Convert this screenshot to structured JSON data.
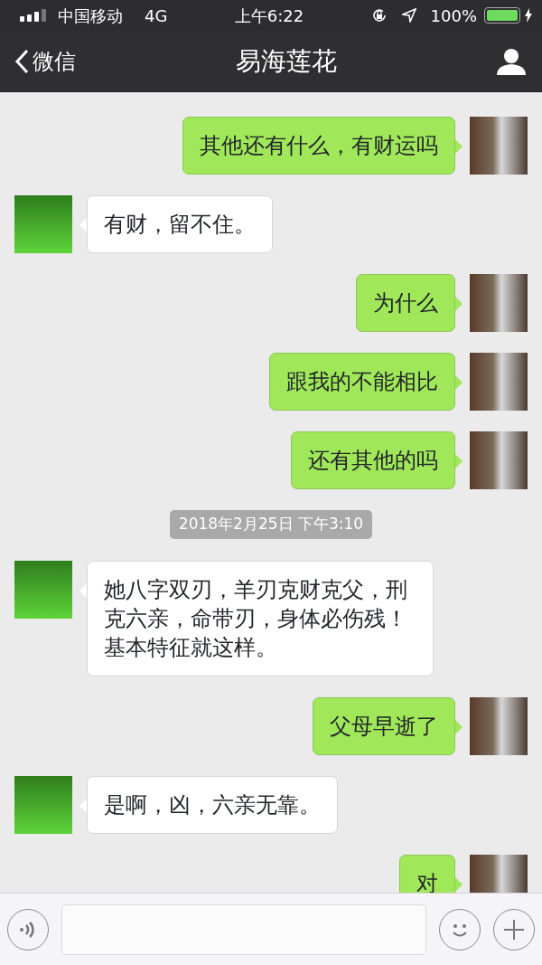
{
  "status_bar": {
    "carrier": "中国移动",
    "network": "4G",
    "time": "上午6:22",
    "battery_text": "100%",
    "battery": {
      "level": 1.0
    }
  },
  "nav": {
    "back_label": "微信",
    "title": "易海莲花"
  },
  "messages": [
    {
      "kind": "outgoing",
      "text": "其他还有什么，有财运吗"
    },
    {
      "kind": "incoming",
      "text": "有财，留不住。"
    },
    {
      "kind": "outgoing",
      "text": "为什么"
    },
    {
      "kind": "outgoing",
      "text": "跟我的不能相比"
    },
    {
      "kind": "outgoing",
      "text": "还有其他的吗"
    },
    {
      "kind": "time",
      "text": "2018年2月25日 下午3:10"
    },
    {
      "kind": "incoming",
      "text": "她八字双刃，羊刃克财克父，刑克六亲，命带刃，身体必伤残！基本特征就这样。"
    },
    {
      "kind": "outgoing",
      "text": "父母早逝了"
    },
    {
      "kind": "incoming",
      "text": "是啊，凶，六亲无靠。"
    },
    {
      "kind": "outgoing",
      "text": "对"
    }
  ]
}
